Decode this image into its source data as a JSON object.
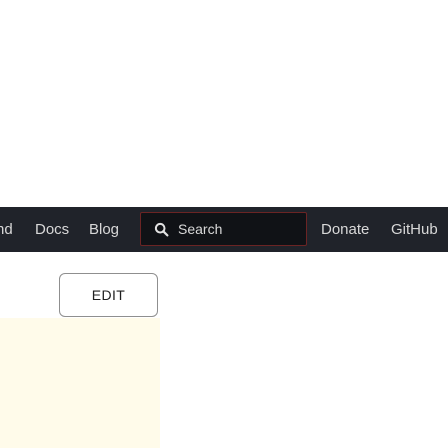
{
  "navbar": {
    "cut_item": "nd",
    "docs": "Docs",
    "blog": "Blog",
    "search": {
      "label": "Search",
      "icon": "search-icon"
    },
    "donate": "Donate",
    "github": "GitHub"
  },
  "content": {
    "edit_button": "EDIT"
  },
  "colors": {
    "navbar_background": "#20232a",
    "search_background": "#101216",
    "search_border": "#6b2424",
    "panel_background": "#fffbea"
  }
}
